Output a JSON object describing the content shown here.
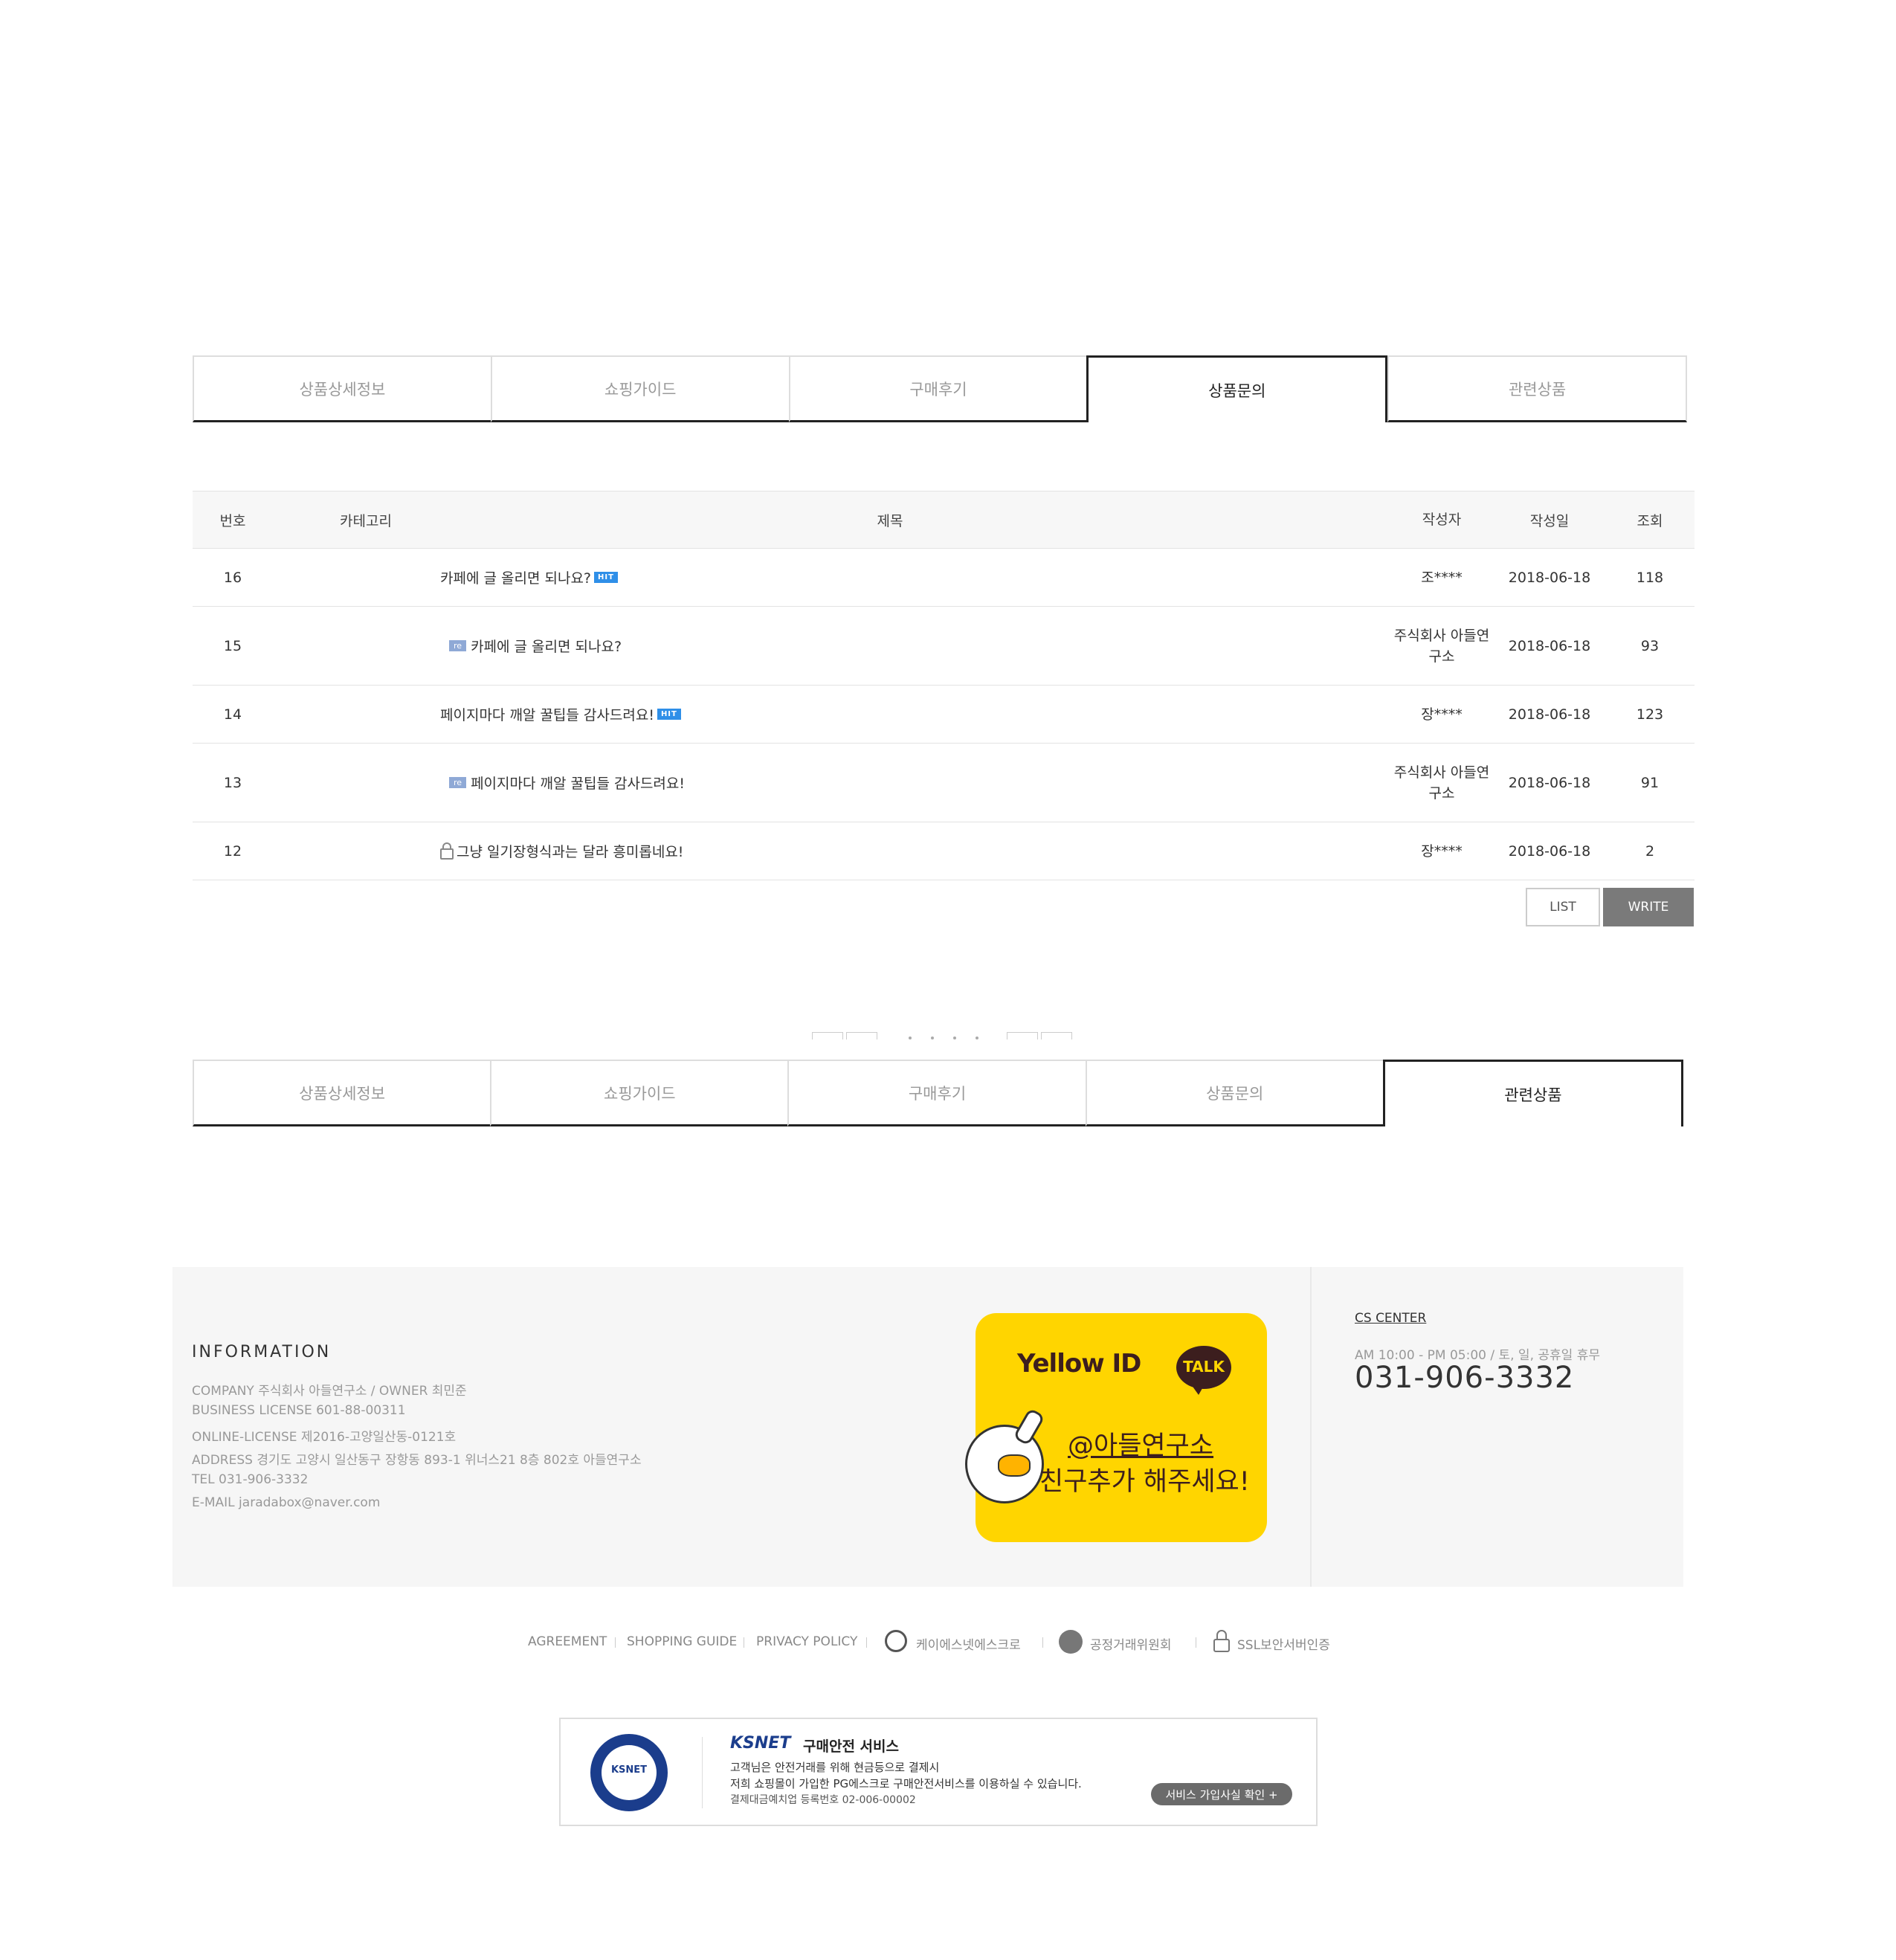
{
  "tabs_top": [
    "상품상세정보",
    "쇼핑가이드",
    "구매후기",
    "상품문의",
    "관련상품"
  ],
  "tabs_top_active": "상품문의",
  "tabs_bottom": [
    "상품상세정보",
    "쇼핑가이드",
    "구매후기",
    "상품문의",
    "관련상품"
  ],
  "tabs_bottom_active": "관련상품",
  "board": {
    "headers": {
      "no": "번호",
      "category": "카테고리",
      "title": "제목",
      "writer": "작성자",
      "date": "작성일",
      "hits": "조회"
    },
    "rows": [
      {
        "no": "16",
        "title": "카페에 글 올리면 되나요?",
        "badge": "HIT",
        "writer": "조****",
        "date": "2018-06-18",
        "hits": "118"
      },
      {
        "no": "15",
        "reply": "re",
        "title": "카페에 글 올리면 되나요?",
        "writer_line1": "주식회사 아들연",
        "writer_line2": "구소",
        "date": "2018-06-18",
        "hits": "93"
      },
      {
        "no": "14",
        "title": "페이지마다 깨알 꿀팁들 감사드려요!",
        "badge": "HIT",
        "writer": "장****",
        "date": "2018-06-18",
        "hits": "123"
      },
      {
        "no": "13",
        "reply": "re",
        "title": "페이지마다 깨알 꿀팁들 감사드려요!",
        "writer_line1": "주식회사 아들연",
        "writer_line2": "구소",
        "date": "2018-06-18",
        "hits": "91"
      },
      {
        "no": "12",
        "title": "그냥 일기장형식과는 달라 흥미롭네요!",
        "writer": "장****",
        "date": "2018-06-18",
        "hits": "2",
        "locked": true
      }
    ],
    "list_button": "LIST",
    "write_button": "WRITE"
  },
  "footer": {
    "info_title": "INFORMATION",
    "info_lines": [
      "COMPANY 주식회사 아들연구소 / OWNER 최민준",
      "BUSINESS LICENSE 601-88-00311",
      "ONLINE-LICENSE 제2016-고양일산동-0121호",
      "ADDRESS 경기도 고양시 일산동구 장항동 893-1 위너스21 8층 802호 아들연구소",
      "TEL 031-906-3332",
      "E-MAIL jaradabox@naver.com"
    ],
    "banner": {
      "brand": "Yellow ID",
      "talk": "TALK",
      "handle": "@아들연구소",
      "cta": "친구추가 해주세요!"
    },
    "cs_title": "CS CENTER",
    "cs_hours": "AM 10:00 - PM 05:00 / 토, 일, 공휴일 휴무",
    "cs_tel": "031-906-3332",
    "links": [
      "AGREEMENT",
      "SHOPPING GUIDE",
      "PRIVACY POLICY",
      "케이에스넷에스크로",
      "공정거래위원회",
      "SSL보안서버인증"
    ],
    "ksnet": {
      "logo": "KSNET",
      "service": "구매안전 서비스",
      "line1": "고객님은 안전거래를 위해 현금등으로 결제시",
      "line2": "저희 쇼핑몰이 가입한 PG에스크로 구매안전서비스를 이용하실 수 있습니다.",
      "line3": "결제대금예치업 등록번호 02-006-00002",
      "button": "서비스 가입사실 확인 +"
    }
  },
  "colors": {
    "accent_hit": "#2f8fe8",
    "reply_badge": "#8fa9d6",
    "yellow_banner": "#ffd500",
    "write_button": "#7a7a7a",
    "ksnet_blue": "#1b3d8c"
  }
}
